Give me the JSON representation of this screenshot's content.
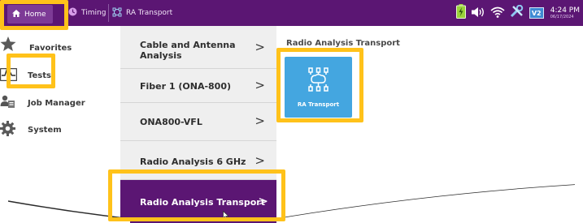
{
  "topbar": {
    "tabs": [
      {
        "label": "Home"
      },
      {
        "label": "Timing"
      },
      {
        "label": "RA Transport"
      }
    ],
    "status": {
      "badge": "V2",
      "time": "4:24 PM",
      "date": "06/17/2024"
    }
  },
  "sidebar": {
    "items": [
      {
        "label": "Favorites",
        "icon": "star-icon"
      },
      {
        "label": "Tests",
        "icon": "tests-icon"
      },
      {
        "label": "Job Manager",
        "icon": "job-manager-icon"
      },
      {
        "label": "System",
        "icon": "gear-icon"
      }
    ]
  },
  "menu": {
    "items": [
      {
        "label": "Cable and Antenna Analysis"
      },
      {
        "label": "Fiber 1 (ONA-800)"
      },
      {
        "label": "ONA800-VFL"
      },
      {
        "label": "Radio Analysis 6 GHz"
      },
      {
        "label": "Radio Analysis Transport"
      }
    ],
    "chevron": ">"
  },
  "pane": {
    "title": "Radio Analysis Transport",
    "tiles": [
      {
        "label": "RA Transport",
        "icon": "network-icon"
      }
    ]
  },
  "colors": {
    "accent_purple": "#5b1673",
    "highlight_yellow": "#ffc21a",
    "tile_blue": "#44a6e0"
  }
}
